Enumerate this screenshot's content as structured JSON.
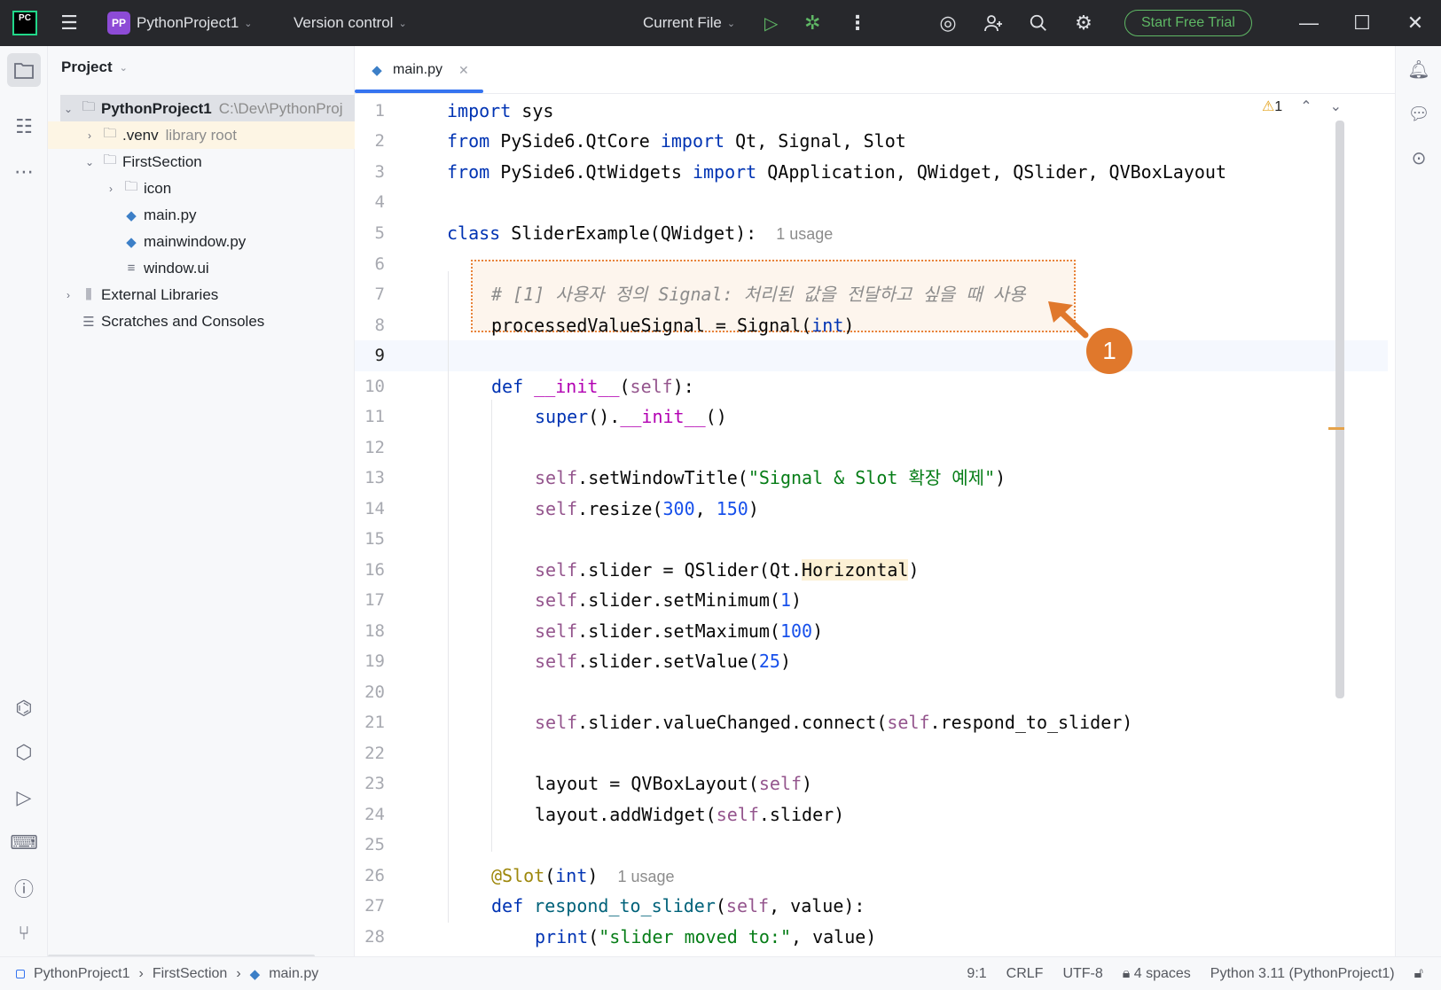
{
  "titlebar": {
    "logo_text": "PC",
    "project_badge": "PP",
    "project_name": "PythonProject1",
    "version_control": "Version control",
    "run_config": "Current File",
    "trial_button": "Start Free Trial"
  },
  "project_panel": {
    "title": "Project",
    "tree": [
      {
        "label": "PythonProject1",
        "note": "C:\\Dev\\PythonProj"
      },
      {
        "label": ".venv",
        "note": "library root"
      },
      {
        "label": "FirstSection"
      },
      {
        "label": "icon"
      },
      {
        "label": "main.py"
      },
      {
        "label": "mainwindow.py"
      },
      {
        "label": "window.ui"
      },
      {
        "label": "External Libraries"
      },
      {
        "label": "Scratches and Consoles"
      }
    ]
  },
  "editor": {
    "tab_label": "main.py",
    "warning_count": "1",
    "line_numbers": [
      "1",
      "2",
      "3",
      "4",
      "5",
      "6",
      "7",
      "8",
      "9",
      "10",
      "11",
      "12",
      "13",
      "14",
      "15",
      "16",
      "17",
      "18",
      "19",
      "20",
      "21",
      "22",
      "23",
      "24",
      "25",
      "26",
      "27",
      "28"
    ],
    "inlay_hint_class": "1 usage",
    "inlay_hint_slot": "1 usage",
    "callout_number": "1"
  },
  "status_bar": {
    "crumbs": [
      "PythonProject1",
      "FirstSection",
      "main.py"
    ],
    "position": "9:1",
    "line_endings": "CRLF",
    "encoding": "UTF-8",
    "indent": "4 spaces",
    "interpreter": "Python 3.11 (PythonProject1)"
  },
  "colors": {
    "accent": "#3574f0",
    "callout": "#e0782c",
    "trial_green": "#5fb865"
  }
}
